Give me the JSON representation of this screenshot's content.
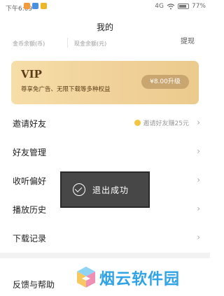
{
  "status_bar": {
    "time": "下午6:09",
    "signal_label": "4G",
    "battery": "77%"
  },
  "header": {
    "title": "我的"
  },
  "wallet": {
    "gold_label": "金币余额(币)",
    "cash_label": "现金余额(元)",
    "withdraw_label": "提现"
  },
  "vip": {
    "title": "VIP",
    "description": "尊享免广告、无限下载等多种权益",
    "button_label": "¥8.00升级"
  },
  "menu": {
    "items": [
      {
        "label": "邀请好友",
        "extra": "邀请好友赚25元"
      },
      {
        "label": "好友管理"
      },
      {
        "label": "收听偏好"
      },
      {
        "label": "播放历史"
      },
      {
        "label": "下载记录"
      }
    ],
    "feedback_label": "反馈与帮助"
  },
  "toast": {
    "message": "退出成功"
  },
  "watermark": {
    "text": "烟云软件园"
  },
  "colors": {
    "vip_gold": "#f0d199",
    "vip_text": "#5a3d17",
    "watermark_blue": "#2fa3e6",
    "toast_bg": "#373737"
  },
  "icons": [
    "wifi-icon",
    "battery-icon",
    "coin-icon",
    "check-circle-icon",
    "chevron-right-icon"
  ]
}
